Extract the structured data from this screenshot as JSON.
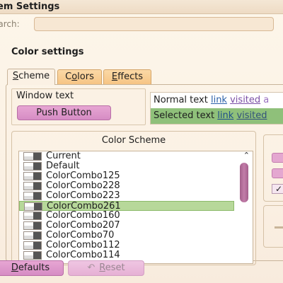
{
  "window": {
    "title": "em Settings"
  },
  "search": {
    "label": "earch:",
    "value": "",
    "placeholder": ""
  },
  "section": {
    "heading": "Color settings"
  },
  "tabs": [
    {
      "label": "Scheme",
      "mnemonic": "S",
      "rest": "cheme",
      "active": true
    },
    {
      "label": "Colors",
      "mnemonic": "o",
      "before": "C",
      "rest": "lors",
      "active": false
    },
    {
      "label": "Effects",
      "mnemonic": "E",
      "rest": "ffects",
      "active": false
    }
  ],
  "preview": {
    "window_text_label": "Window text",
    "push_button_label": "Push Button",
    "normal": {
      "text": "Normal text",
      "link": "link",
      "visited": "visited",
      "extra": "a"
    },
    "selected": {
      "text": "Selected text",
      "link": "link",
      "visited": "visited"
    }
  },
  "color_scheme": {
    "title": "Color Scheme",
    "items": [
      "Current",
      "Default",
      "ColorCombo125",
      "ColorCombo228",
      "ColorCombo223",
      "ColorCombo261",
      "ColorCombo160",
      "ColorCombo207",
      "ColorCombo70",
      "ColorCombo112",
      "ColorCombo114"
    ],
    "selected": "ColorCombo261"
  },
  "buttons": {
    "defaults": "Defaults",
    "defaults_mn": "D",
    "defaults_rest": "efaults",
    "reset": "Reset",
    "reset_mn": "R",
    "reset_rest": "eset"
  },
  "colors": {
    "accent_pink": "#d68cc4",
    "tab_orange": "#f6c484",
    "selection_green": "#b7d89a",
    "link_blue": "#2a5fa8",
    "visited_purple": "#7b4fa6"
  }
}
